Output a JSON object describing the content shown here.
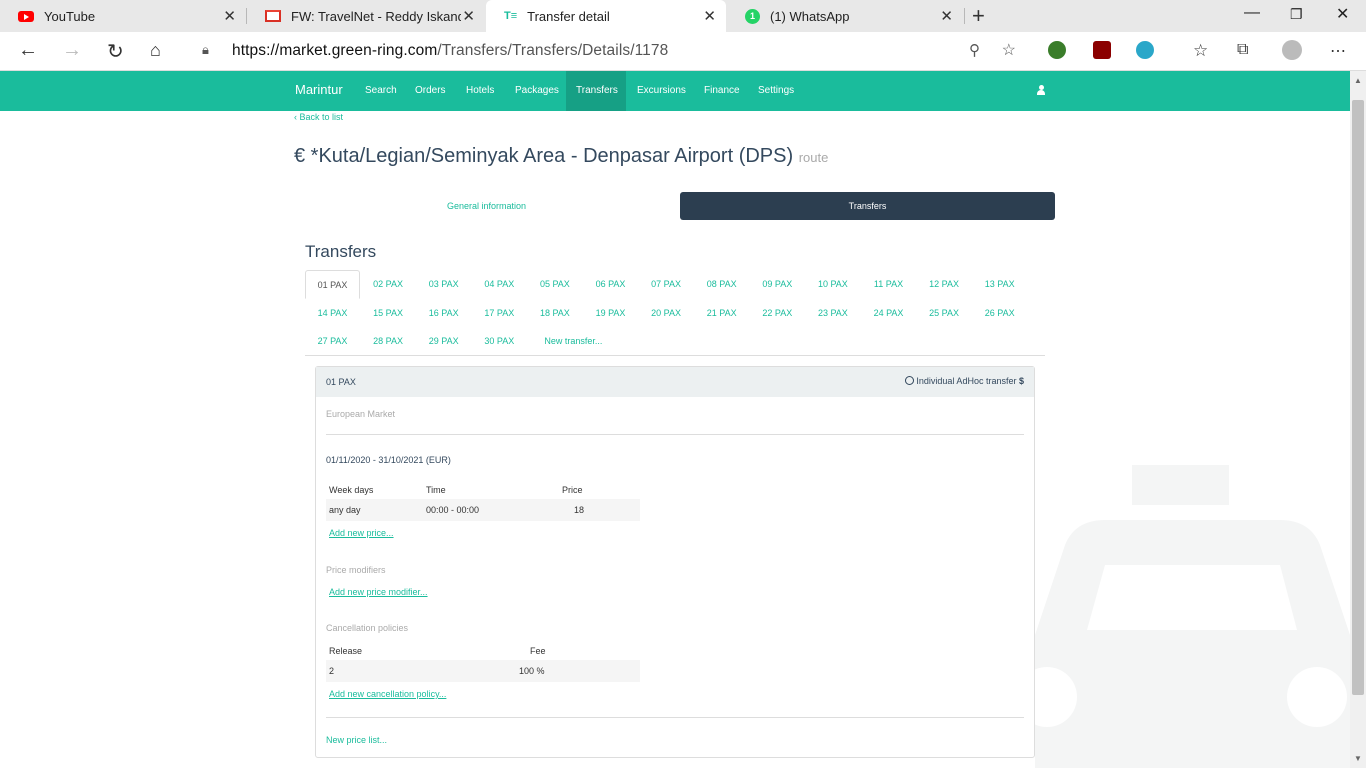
{
  "browser": {
    "tabs": [
      {
        "title": "YouTube",
        "icon": "youtube-icon"
      },
      {
        "title": "FW: TravelNet - Reddy Iskandar I",
        "icon": "gmail-icon"
      },
      {
        "title": "Transfer detail",
        "icon": "travelnet-icon"
      },
      {
        "title": "(1) WhatsApp",
        "icon": "whatsapp-icon"
      }
    ],
    "url_prefix": "https://market.green-ring.com",
    "url_path": "/Transfers/Transfers/Details/1178"
  },
  "site": {
    "brand": "Marintur",
    "nav": [
      "Search",
      "Orders",
      "Hotels",
      "Packages",
      "Transfers",
      "Excursions",
      "Finance",
      "Settings"
    ],
    "active_nav": "Transfers",
    "accent": "#1abc9c"
  },
  "page": {
    "back": "‹ Back to list",
    "title": "€ *Kuta/Legian/Seminyak Area - Denpasar Airport (DPS)",
    "title_suffix": "route",
    "subtabs": [
      "General information",
      "Transfers"
    ],
    "section_title": "Transfers",
    "pax_tabs": [
      "01 PAX",
      "02 PAX",
      "03 PAX",
      "04 PAX",
      "05 PAX",
      "06 PAX",
      "07 PAX",
      "08 PAX",
      "09 PAX",
      "10 PAX",
      "11 PAX",
      "12 PAX",
      "13 PAX",
      "14 PAX",
      "15 PAX",
      "16 PAX",
      "17 PAX",
      "18 PAX",
      "19 PAX",
      "20 PAX",
      "21 PAX",
      "22 PAX",
      "23 PAX",
      "24 PAX",
      "25 PAX",
      "26 PAX",
      "27 PAX",
      "28 PAX",
      "29 PAX",
      "30 PAX",
      "New transfer..."
    ],
    "active_pax": "01 PAX"
  },
  "panel": {
    "header_left": "01 PAX",
    "header_right": "Individual AdHoc transfer",
    "header_currency": "$",
    "market": "European Market",
    "period": "01/11/2020 - 31/10/2021 (EUR)",
    "price_table": {
      "headers": [
        "Week days",
        "Time",
        "Price"
      ],
      "rows": [
        [
          "any day",
          "00:00 - 00:00",
          "18"
        ]
      ]
    },
    "add_price": "Add new price...",
    "price_modifiers_label": "Price modifiers",
    "add_modifier": "Add new price modifier...",
    "cancellation_label": "Cancellation policies",
    "cancel_table": {
      "headers": [
        "Release",
        "Fee"
      ],
      "rows": [
        [
          "2",
          "100 %"
        ]
      ]
    },
    "add_cancel": "Add new cancellation policy...",
    "new_price_list": "New price list..."
  }
}
